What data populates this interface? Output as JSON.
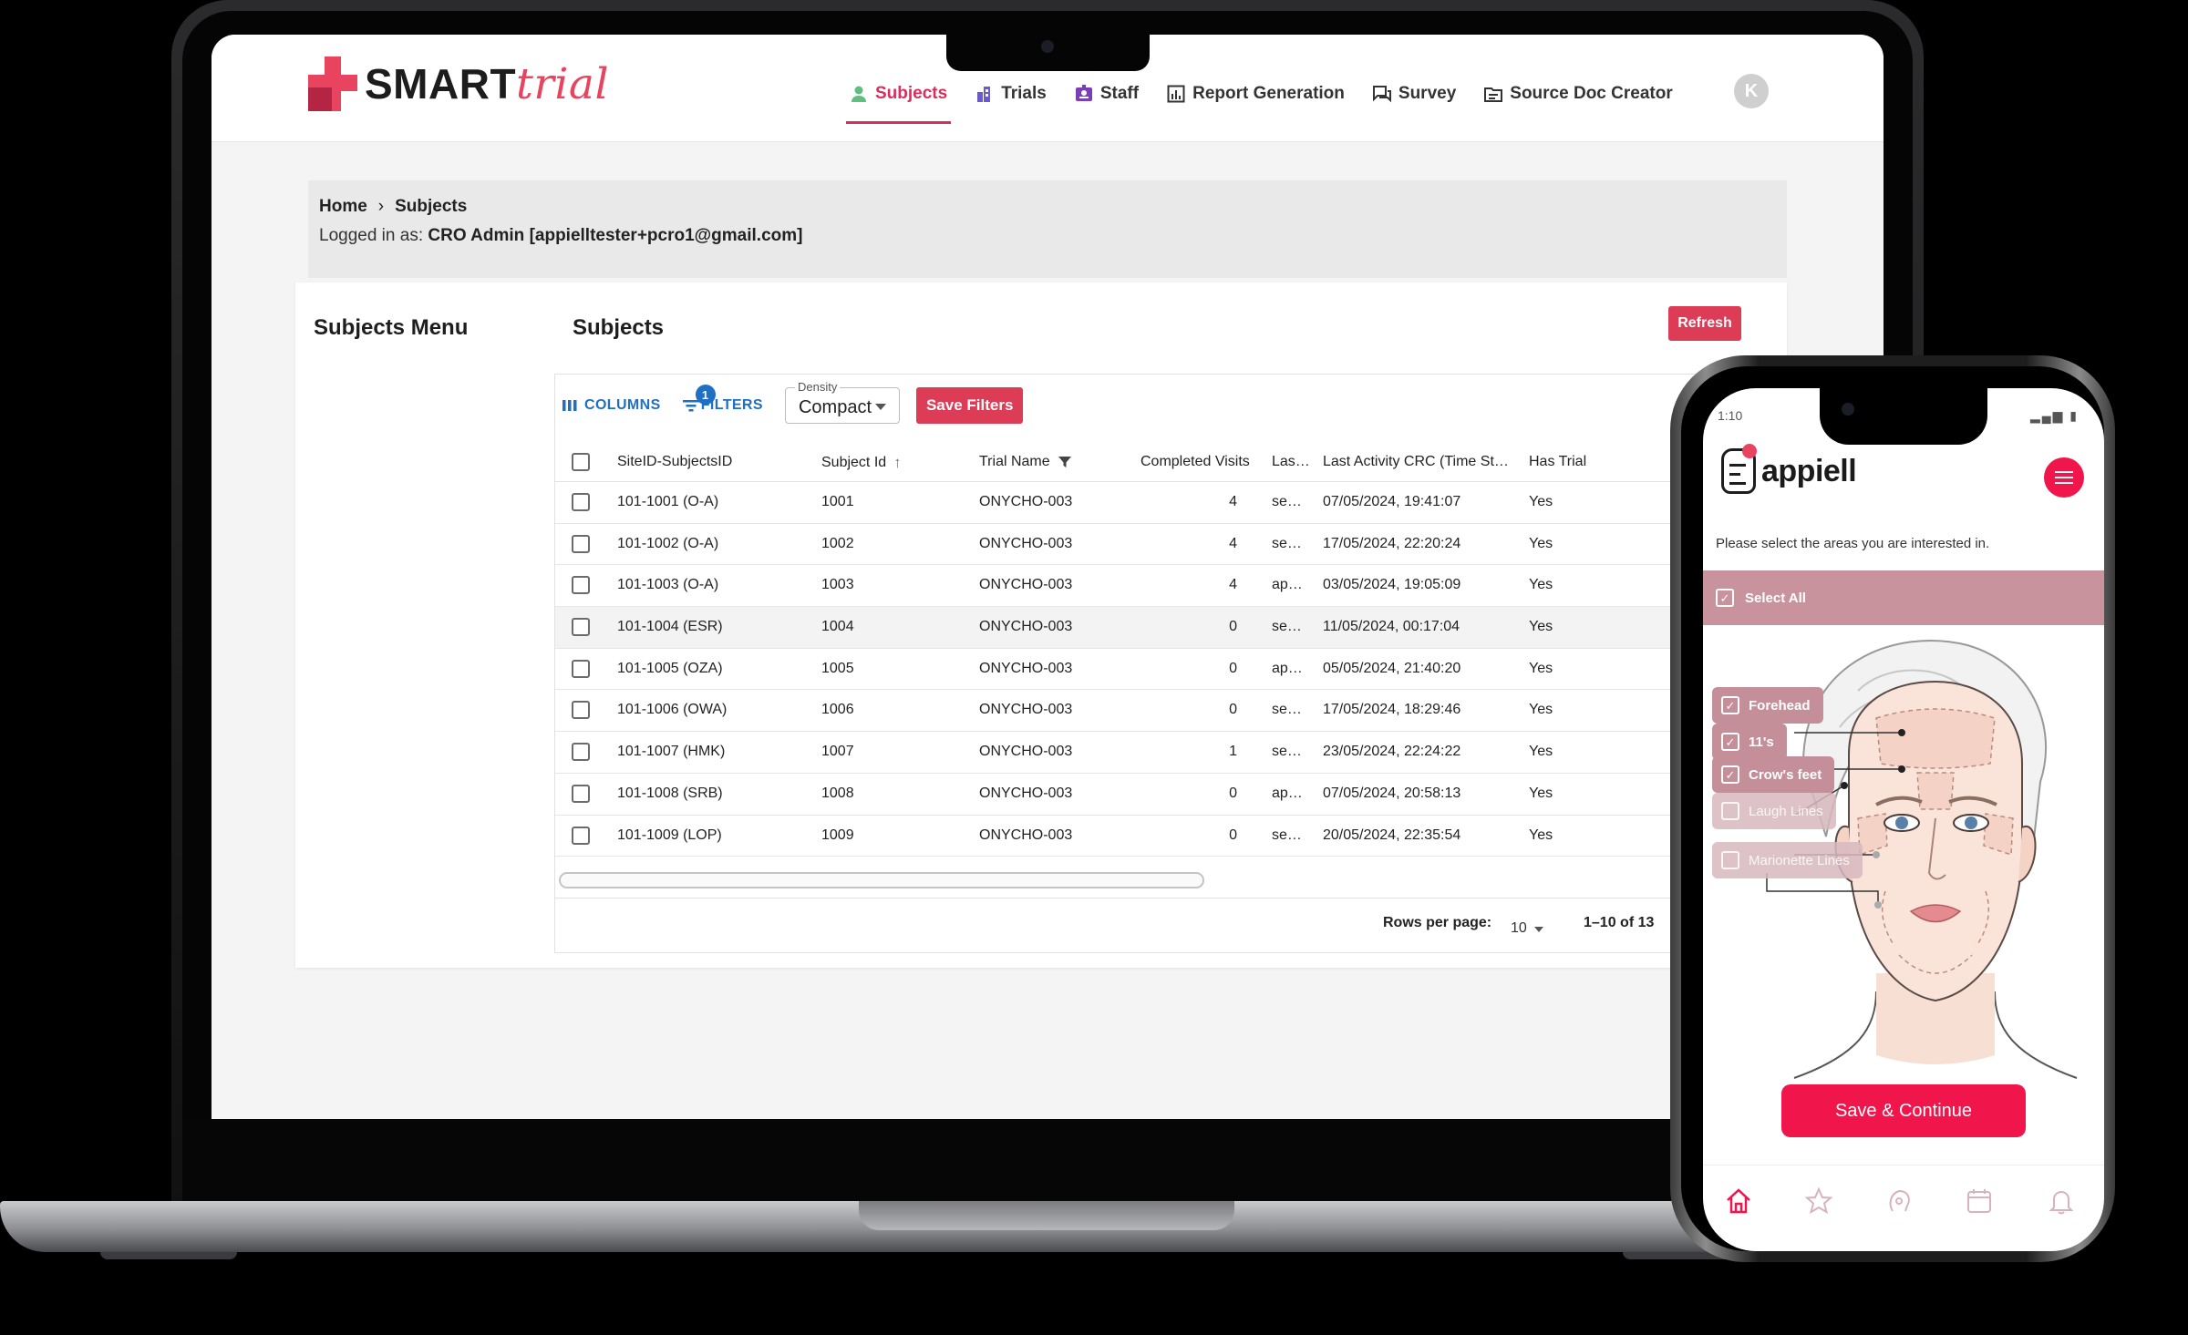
{
  "laptop": {
    "app": {
      "logo": {
        "main": "SMART",
        "accent": "trial"
      },
      "nav": [
        {
          "label": "Subjects",
          "icon": "person-icon",
          "active": true
        },
        {
          "label": "Trials",
          "icon": "building-icon",
          "active": false
        },
        {
          "label": "Staff",
          "icon": "id-badge-icon",
          "active": false
        },
        {
          "label": "Report Generation",
          "icon": "chart-icon",
          "active": false
        },
        {
          "label": "Survey",
          "icon": "chat-icon",
          "active": false
        },
        {
          "label": "Source Doc Creator",
          "icon": "document-icon",
          "active": false
        }
      ],
      "avatar_initial": "K",
      "breadcrumb": {
        "home": "Home",
        "current": "Subjects"
      },
      "logged_in": {
        "prefix": "Logged in as:",
        "role": "CRO Admin",
        "email": "[appielltester+pcro1@gmail.com]"
      },
      "menu_title": "Subjects Menu",
      "page_title": "Subjects",
      "refresh_label": "Refresh",
      "toolbar": {
        "columns_label": "COLUMNS",
        "filters_label": "FILTERS",
        "filters_badge": "1",
        "density_label": "Density",
        "density_value": "Compact",
        "save_filters_label": "Save Filters"
      },
      "columns": [
        "SiteID-SubjectsID",
        "Subject Id",
        "Trial Name",
        "Completed Visits",
        "Las…",
        "Last Activity CRC (Time St…",
        "Has Trial"
      ],
      "rows": [
        {
          "site": "101-1001 (O-A)",
          "id": "1001",
          "trial": "ONYCHO-003",
          "visits": "4",
          "last": "se…",
          "activity": "07/05/2024, 19:41:07",
          "has": "Yes"
        },
        {
          "site": "101-1002 (O-A)",
          "id": "1002",
          "trial": "ONYCHO-003",
          "visits": "4",
          "last": "se…",
          "activity": "17/05/2024, 22:20:24",
          "has": "Yes"
        },
        {
          "site": "101-1003 (O-A)",
          "id": "1003",
          "trial": "ONYCHO-003",
          "visits": "4",
          "last": "ap…",
          "activity": "03/05/2024, 19:05:09",
          "has": "Yes"
        },
        {
          "site": "101-1004 (ESR)",
          "id": "1004",
          "trial": "ONYCHO-003",
          "visits": "0",
          "last": "se…",
          "activity": "11/05/2024, 00:17:04",
          "has": "Yes"
        },
        {
          "site": "101-1005 (OZA)",
          "id": "1005",
          "trial": "ONYCHO-003",
          "visits": "0",
          "last": "ap…",
          "activity": "05/05/2024, 21:40:20",
          "has": "Yes"
        },
        {
          "site": "101-1006 (OWA)",
          "id": "1006",
          "trial": "ONYCHO-003",
          "visits": "0",
          "last": "se…",
          "activity": "17/05/2024, 18:29:46",
          "has": "Yes"
        },
        {
          "site": "101-1007 (HMK)",
          "id": "1007",
          "trial": "ONYCHO-003",
          "visits": "1",
          "last": "se…",
          "activity": "23/05/2024, 22:24:22",
          "has": "Yes"
        },
        {
          "site": "101-1008 (SRB)",
          "id": "1008",
          "trial": "ONYCHO-003",
          "visits": "0",
          "last": "ap…",
          "activity": "07/05/2024, 20:58:13",
          "has": "Yes"
        },
        {
          "site": "101-1009 (LOP)",
          "id": "1009",
          "trial": "ONYCHO-003",
          "visits": "0",
          "last": "se…",
          "activity": "20/05/2024, 22:35:54",
          "has": "Yes"
        }
      ],
      "pagination": {
        "rows_per_page_label": "Rows per page:",
        "rows_per_page": "10",
        "range": "1–10 of 13"
      }
    }
  },
  "phone": {
    "status_time": "1:10",
    "logo": "appiell",
    "prompt": "Please select the areas you are interested in.",
    "select_all_label": "Select All",
    "areas": [
      {
        "label": "Forehead",
        "checked": true
      },
      {
        "label": "11's",
        "checked": true
      },
      {
        "label": "Crow's feet",
        "checked": true
      },
      {
        "label": "Laugh Lines",
        "checked": false
      },
      {
        "label": "Marionette Lines",
        "checked": false
      }
    ],
    "save_continue_label": "Save & Continue",
    "tabs": [
      "home-icon",
      "star-icon",
      "face-icon",
      "calendar-icon",
      "bell-icon"
    ]
  },
  "colors": {
    "brand_red": "#dd3c56",
    "link_blue": "#1f6fc5",
    "appiell_pink": "#f0164b",
    "chip_rose": "#c58f99"
  }
}
